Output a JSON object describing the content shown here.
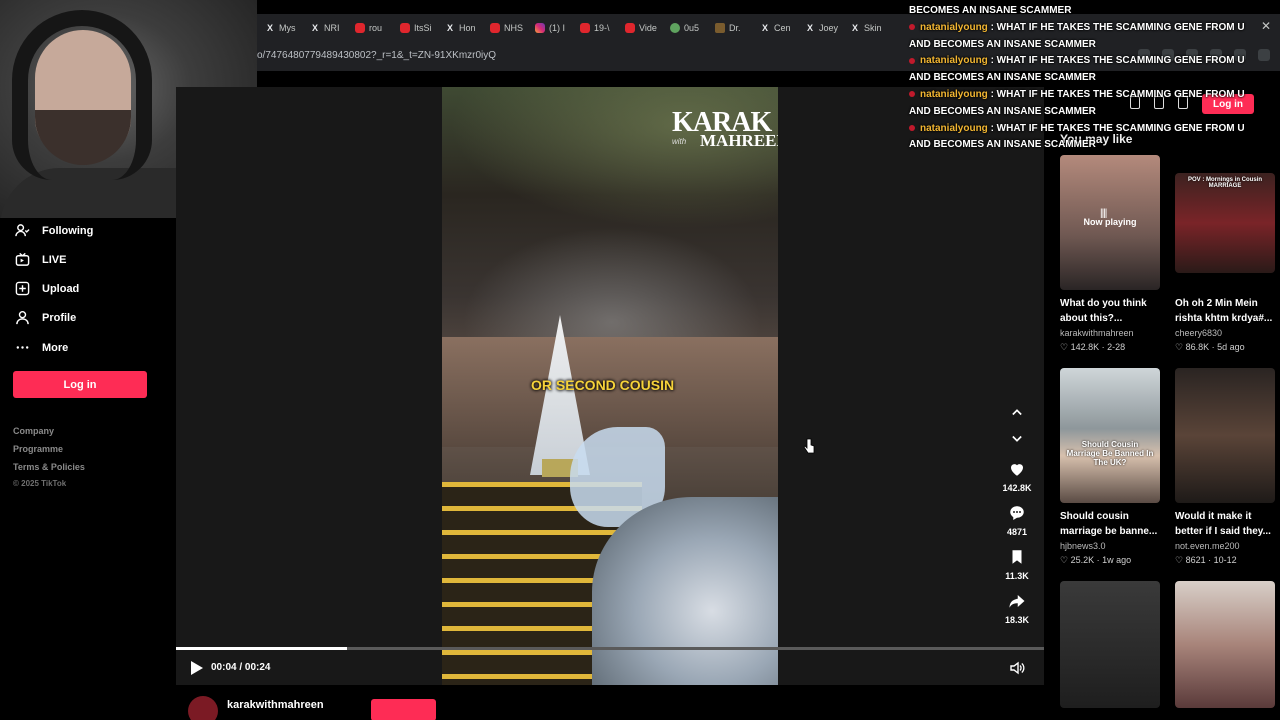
{
  "browser": {
    "tabs": [
      {
        "icon": "x-icon",
        "label": "Mys"
      },
      {
        "icon": "x-icon",
        "label": "NRI"
      },
      {
        "icon": "youtube-icon",
        "label": "rou"
      },
      {
        "icon": "youtube-icon",
        "label": "ItsSi"
      },
      {
        "icon": "x-icon",
        "label": "Hon"
      },
      {
        "icon": "youtube-icon",
        "label": "NHS"
      },
      {
        "icon": "instagram-icon",
        "label": "(1) I"
      },
      {
        "icon": "youtube-icon",
        "label": "19-\\"
      },
      {
        "icon": "youtube-icon",
        "label": "Vide"
      },
      {
        "icon": "green-globe-icon",
        "label": "0u5"
      },
      {
        "icon": "d-icon",
        "label": "Dr."
      },
      {
        "icon": "x-icon",
        "label": "Cen"
      },
      {
        "icon": "x-icon",
        "label": "Joey"
      },
      {
        "icon": "x-icon",
        "label": "Skin"
      }
    ],
    "close_glyph": "✕",
    "url": "o/7476480779489430802?_r=1&_t=ZN-91XKmzr0iyQ"
  },
  "sidebar": {
    "items": [
      {
        "icon": "following-icon",
        "label": "Following"
      },
      {
        "icon": "live-icon",
        "label": "LIVE"
      },
      {
        "icon": "upload-icon",
        "label": "Upload"
      },
      {
        "icon": "profile-icon",
        "label": "Profile"
      },
      {
        "icon": "more-icon",
        "label": "More"
      }
    ],
    "login_label": "Log in",
    "footer": [
      "Company",
      "Programme",
      "Terms & Policies"
    ],
    "copyright": "© 2025 TikTok"
  },
  "video": {
    "brand_line1": "KARAK",
    "brand_line2": "MAHREEN",
    "brand_with": "with",
    "caption": "OR SECOND COUSIN",
    "actions": [
      {
        "icon": "heart-icon",
        "count": "142.8K"
      },
      {
        "icon": "comment-icon",
        "count": "4871"
      },
      {
        "icon": "bookmark-icon",
        "count": "11.3K"
      },
      {
        "icon": "share-icon",
        "count": "18.3K"
      }
    ],
    "time": "00:04 / 00:24",
    "progress_fraction": 0.1967,
    "author": "karakwithmahreen"
  },
  "right": {
    "login_label": "Log in",
    "section_title": "You may like",
    "cards": [
      {
        "title": "What do you think about this?...",
        "author": "karakwithmahreen",
        "stats": "142.8K · 2-28",
        "overlay": "Now playing",
        "bars": "||||"
      },
      {
        "title": "Oh oh 2 Min Mein rishta khtm krdya#...",
        "author": "cheery6830",
        "stats": "86.8K · 5d ago",
        "overlay": "POV : Mornings in Cousin MARRIAGE"
      },
      {
        "title": "Should cousin marriage be banne...",
        "author": "hjbnews3.0",
        "stats": "25.2K · 1w ago",
        "overlay": "Should Cousin Marriage Be Banned In The UK?"
      },
      {
        "title": "Would it make it better if I said they...",
        "author": "not.even.me200",
        "stats": "8621 · 10-12",
        "overlay": ""
      },
      {
        "title": "",
        "author": "",
        "stats": "",
        "overlay": ""
      },
      {
        "title": "",
        "author": "",
        "stats": "",
        "overlay": ""
      }
    ]
  },
  "chat": {
    "first_line": "BECOMES AN INSANE SCAMMER",
    "messages": [
      {
        "user": "natanialyoung",
        "text": ": WHAT IF HE TAKES THE SCAMMING GENE FROM U AND BECOMES AN INSANE SCAMMER"
      },
      {
        "user": "natanialyoung",
        "text": ": WHAT IF HE TAKES THE SCAMMING GENE FROM U AND BECOMES AN INSANE SCAMMER"
      },
      {
        "user": "natanialyoung",
        "text": ": WHAT IF HE TAKES THE SCAMMING GENE FROM U AND BECOMES AN INSANE SCAMMER"
      },
      {
        "user": "natanialyoung",
        "text": ": WHAT IF HE TAKES THE SCAMMING GENE FROM U AND BECOMES AN INSANE SCAMMER"
      }
    ]
  },
  "colors": {
    "accent": "#fe2c55",
    "chat_user": "#f2b632",
    "caption": "#f6d33a"
  }
}
